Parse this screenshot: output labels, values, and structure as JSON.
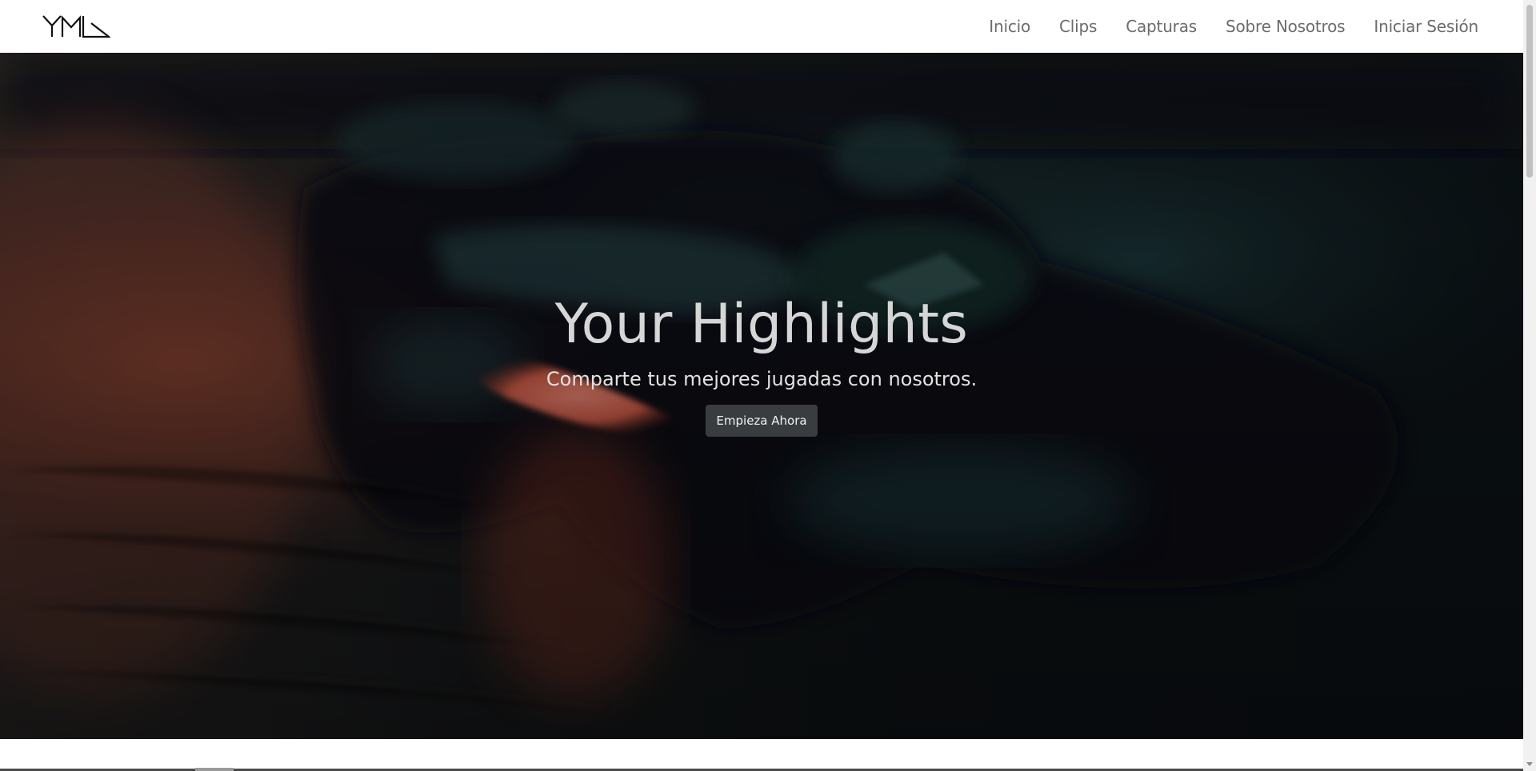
{
  "brand": {
    "logo_icon": "yml-logo-icon"
  },
  "nav": {
    "items": [
      {
        "label": "Inicio"
      },
      {
        "label": "Clips"
      },
      {
        "label": "Capturas"
      },
      {
        "label": "Sobre Nosotros"
      },
      {
        "label": "Iniciar Sesión"
      }
    ]
  },
  "hero": {
    "title": "Your Highlights",
    "subtitle": "Comparte tus mejores jugadas con nosotros.",
    "cta_label": "Empieza Ahora",
    "background_icon": "game-controller-photo"
  },
  "colors": {
    "nav_text": "#6c6c6c",
    "hero_title": "#d6d6d6",
    "button_bg": "#3a3d40"
  }
}
